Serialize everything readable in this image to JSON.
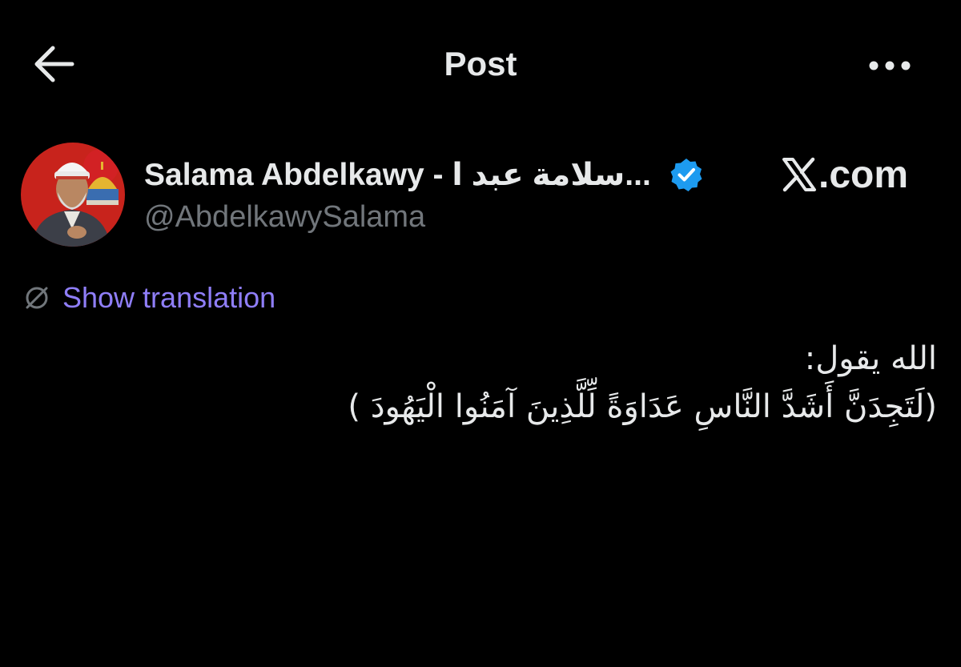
{
  "header": {
    "title": "Post",
    "back_icon": "arrow-left-icon",
    "more_icon": "more-horizontal-icon"
  },
  "author": {
    "display_name": "Salama Abdelkawy - سلامة عبد ا...",
    "handle": "@AbdelkawySalama",
    "verified": true,
    "verified_icon": "verified-badge-icon",
    "avatar_icon": "avatar-photo"
  },
  "source": {
    "site": ".com",
    "logo_icon": "x-logo-icon"
  },
  "translation": {
    "label": "Show translation",
    "icon": "translate-globe-icon"
  },
  "tweet": {
    "lines": [
      "الله يقول:",
      "(لَتَجِدَنَّ أَشَدَّ النَّاسِ عَدَاوَةً لِّلَّذِينَ آمَنُوا الْيَهُودَ )"
    ]
  },
  "colors": {
    "background": "#000000",
    "text": "#e7e9ea",
    "muted": "#71767b",
    "accent": "#8f7ef8",
    "verified": "#1d9bf0"
  }
}
